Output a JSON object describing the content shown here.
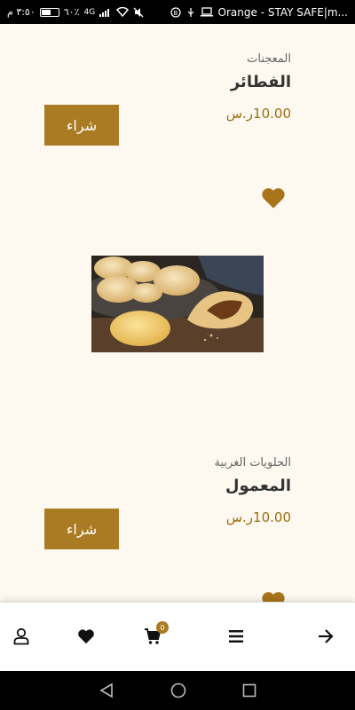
{
  "status_bar": {
    "time": "٣:٥٠ م",
    "battery": "٦٠٪",
    "network": "4G",
    "carrier": "Orange - STAY SAFE|m..."
  },
  "products": [
    {
      "category": "المعجنات",
      "title": "الفطائر",
      "price": "10.00ر.س",
      "buy_label": "شراء"
    },
    {
      "category": "الحلويات الغربية",
      "title": "المعمول",
      "price": "10.00ر.س",
      "buy_label": "شراء"
    }
  ],
  "bottom_nav": {
    "items": [
      "user-icon",
      "heart-icon",
      "cart-icon",
      "menu-icon",
      "arrow-right-icon"
    ],
    "cart_count": "0"
  },
  "colors": {
    "accent": "#ab7b23",
    "background": "#fdf9f1",
    "price": "#9a6d12"
  }
}
